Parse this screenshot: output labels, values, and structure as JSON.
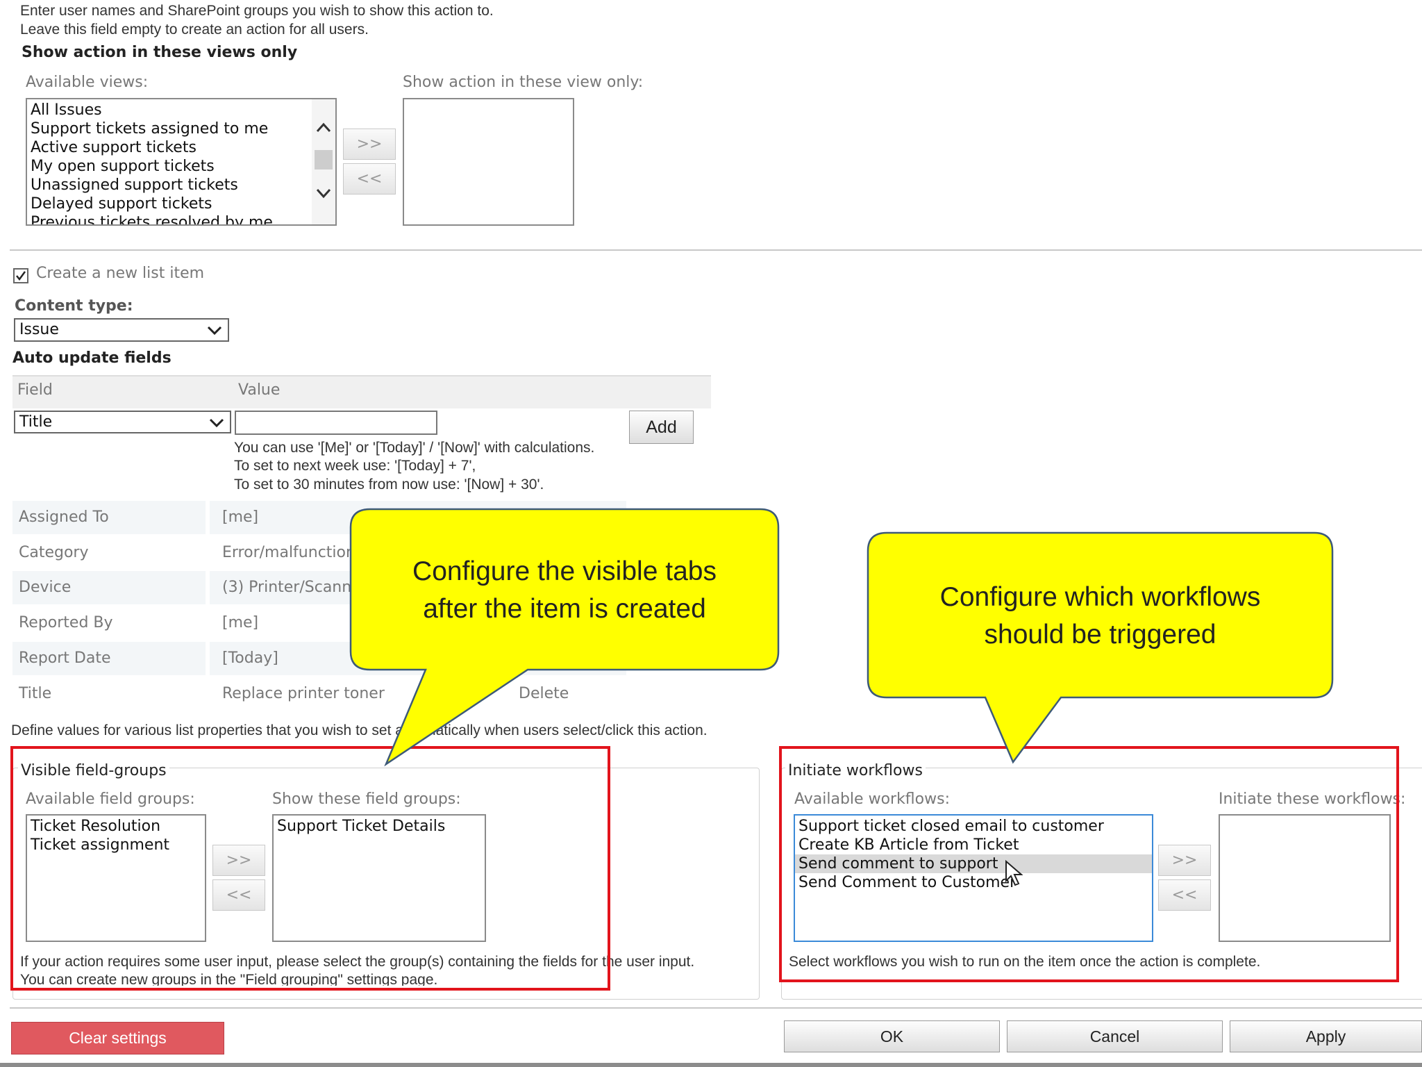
{
  "audience": {
    "help_line1": "Enter user names and SharePoint groups you wish to show this action to.",
    "help_line2": "Leave this field empty to create an action for all users."
  },
  "views": {
    "heading": "Show action in these views only",
    "available_label": "Available views:",
    "selected_label": "Show action in these view only:",
    "available_items": [
      "All Issues",
      "Support tickets assigned to me",
      "Active support tickets",
      "My open support tickets",
      "Unassigned support tickets",
      "Delayed support tickets",
      "Previous tickets resolved by me"
    ],
    "add_label": ">>",
    "remove_label": "<<"
  },
  "create_item": {
    "checkbox_label": "Create a new list item",
    "checked": true,
    "content_type_label": "Content type:",
    "content_type_value": "Issue"
  },
  "auto_update": {
    "heading": "Auto update fields",
    "col_field": "Field",
    "col_value": "Value",
    "field_select_value": "Title",
    "value_input": "",
    "add_button": "Add",
    "hint1": "You can use '[Me]' or '[Today]' / '[Now]' with calculations.",
    "hint2": "To set to next week use: '[Today] + 7',",
    "hint3": "To set to 30 minutes from now use: '[Now] + 30'.",
    "rows": [
      {
        "field": "Assigned To",
        "value": "[me]"
      },
      {
        "field": "Category",
        "value": "Error/malfunction"
      },
      {
        "field": "Device",
        "value": "(3) Printer/Scanner"
      },
      {
        "field": "Reported By",
        "value": "[me]"
      },
      {
        "field": "Report Date",
        "value": "[Today]"
      },
      {
        "field": "Title",
        "value": "Replace printer toner",
        "action": "Delete"
      }
    ],
    "define_help": "Define values for various list properties that you wish to set automatically when users select/click this action."
  },
  "field_groups": {
    "legend": "Visible field-groups",
    "available_label": "Available field groups:",
    "selected_label": "Show these field groups:",
    "available_items": [
      "Ticket Resolution",
      "Ticket assignment"
    ],
    "selected_items": [
      "Support Ticket Details"
    ],
    "add_label": ">>",
    "remove_label": "<<",
    "help1": "If your action requires some user input, please select the group(s) containing the fields for the user input.",
    "help2": "You can create new groups in the \"Field grouping\" settings page."
  },
  "workflows": {
    "legend": "Initiate workflows",
    "available_label": "Available workflows:",
    "selected_label": "Initiate these workflows:",
    "available_items": [
      "Support ticket closed email to customer",
      "Create KB Article from Ticket",
      "Send comment to support",
      "Send Comment to Customer"
    ],
    "highlighted_index": 2,
    "add_label": ">>",
    "remove_label": "<<",
    "help": "Select workflows you wish to run on the item once the action is complete."
  },
  "callouts": {
    "tabs_line1": "Configure the visible tabs",
    "tabs_line2": "after the item is created",
    "workflows_line1": "Configure which workflows",
    "workflows_line2": "should be triggered"
  },
  "footer": {
    "clear": "Clear settings",
    "ok": "OK",
    "cancel": "Cancel",
    "apply": "Apply"
  },
  "colors": {
    "callout_fill": "#ffff00",
    "highlight_border": "#e2141c",
    "clear_button": "#e0595f"
  }
}
